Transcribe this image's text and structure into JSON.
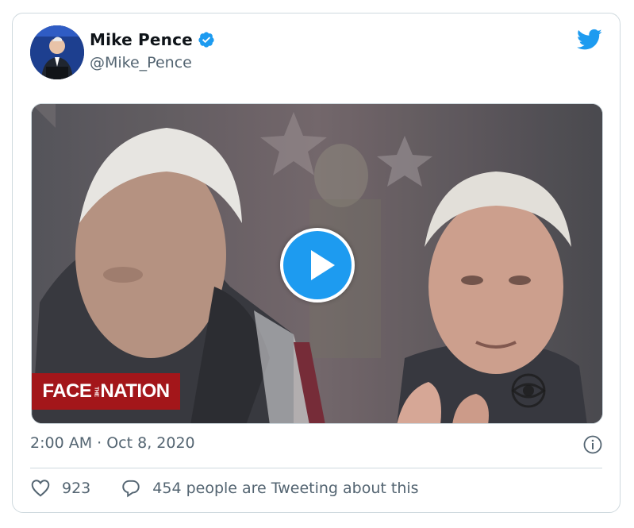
{
  "tweet": {
    "author": {
      "display_name": "Mike Pence",
      "handle": "@Mike_Pence",
      "verified": true
    },
    "media": {
      "type": "video",
      "overlay_logo_text": [
        "FACE",
        "THE",
        "NATION"
      ]
    },
    "timestamp": "2:00 AM · Oct 8, 2020",
    "likes": "923",
    "conversation_text": "454 people are Tweeting about this"
  },
  "colors": {
    "brand_blue": "#1d9bf0",
    "text_primary": "#0f1419",
    "text_secondary": "#536471",
    "border": "#cfd9de",
    "face_the_nation_red": "#a3161a"
  },
  "icons": {
    "verified": "verified-badge-icon",
    "brand": "twitter-bird-icon",
    "play": "play-icon",
    "info": "info-icon",
    "like": "heart-icon",
    "reply": "speech-bubble-icon"
  }
}
